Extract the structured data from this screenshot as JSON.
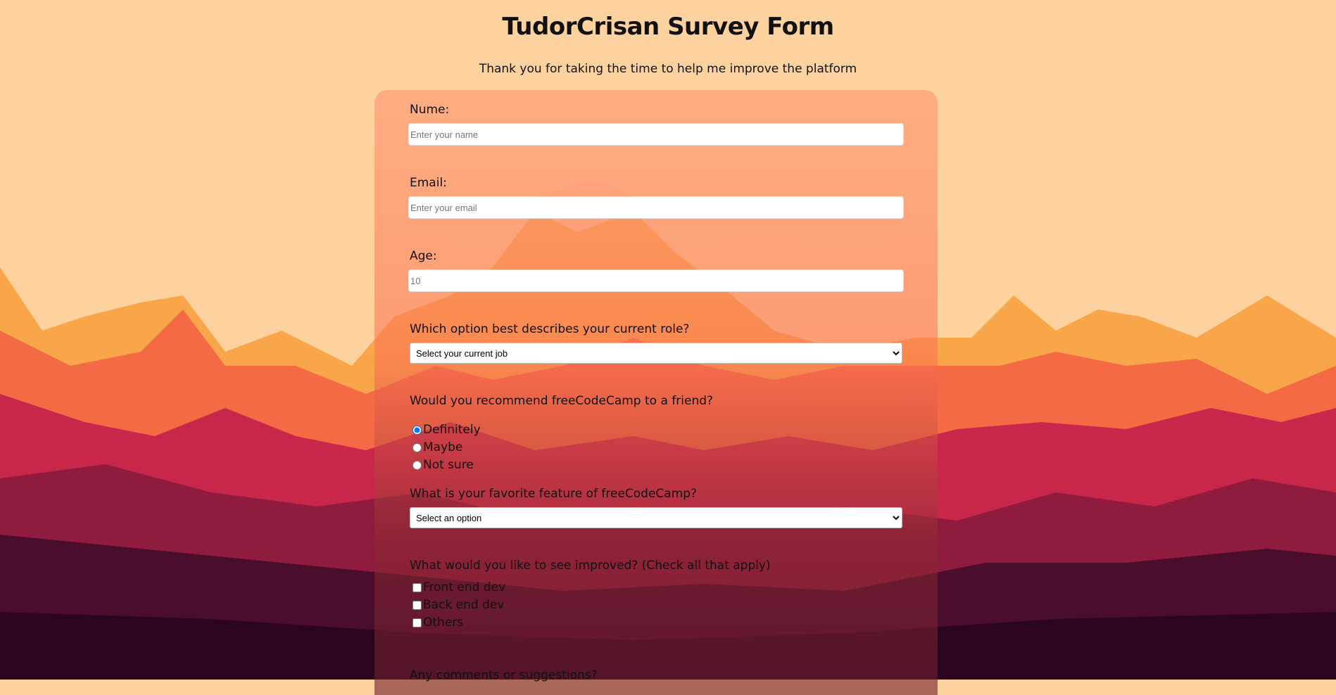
{
  "header": {
    "title": "TudorCrisan Survey Form",
    "subtitle": "Thank you for taking the time to help me improve the platform"
  },
  "form": {
    "name": {
      "label": "Nume:",
      "placeholder": "Enter your name"
    },
    "email": {
      "label": "Email:",
      "placeholder": "Enter your email"
    },
    "age": {
      "label": "Age:",
      "placeholder": "10"
    },
    "role": {
      "label": "Which option best describes your current role?",
      "selected": "Select your current job"
    },
    "recommend": {
      "label": "Would you recommend freeCodeCamp to a friend?",
      "options": [
        "Definitely",
        "Maybe",
        "Not sure"
      ],
      "checked_index": 0
    },
    "feature": {
      "label": "What is your favorite feature of freeCodeCamp?",
      "selected": "Select an option"
    },
    "improve": {
      "label": "What would you like to see improved? (Check all that apply)",
      "options": [
        "Front end dev",
        "Back end dev",
        "Others"
      ]
    },
    "comments": {
      "label": "Any comments or suggestions?"
    }
  },
  "colors": {
    "sky": "#fed29f",
    "panel_top": "#ffa57d",
    "accent": "#1a73e8"
  }
}
